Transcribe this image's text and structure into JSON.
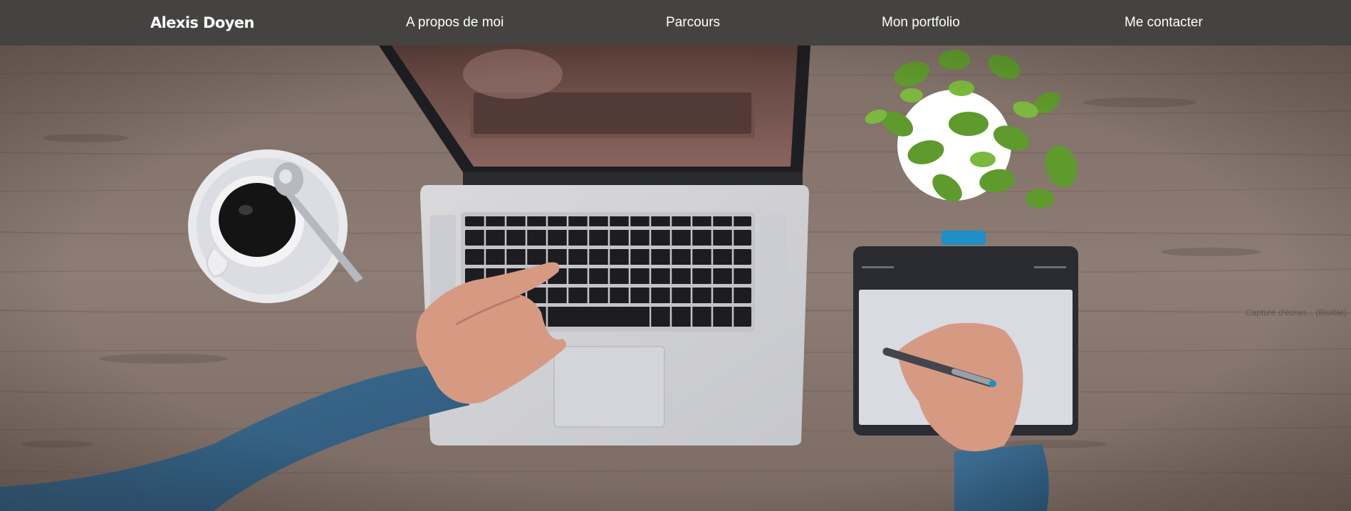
{
  "header": {
    "brand": "Alexis Doyen",
    "nav": [
      {
        "label": "A propos de moi"
      },
      {
        "label": "Parcours"
      },
      {
        "label": "Mon portfolio"
      },
      {
        "label": "Me contacter"
      }
    ]
  },
  "hero": {
    "image": "desk-workspace-photo",
    "credit": "Capture d'écran... (illisible)"
  },
  "colors": {
    "navbar_bg": "#454341",
    "nav_text": "#ffffff",
    "desk_wood": "#8a7a72"
  }
}
